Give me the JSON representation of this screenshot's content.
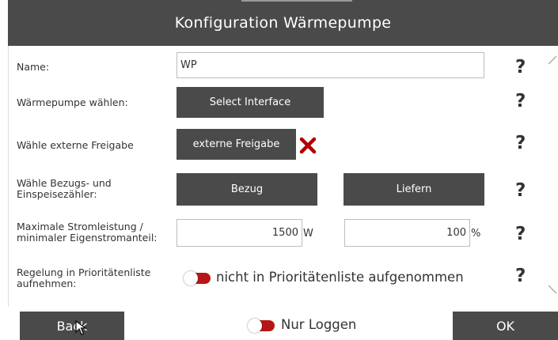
{
  "title": "Konfiguration Wärmepumpe",
  "rows": {
    "name": {
      "label": "Name:",
      "value": "WP"
    },
    "heatpump": {
      "label": "Wärmepumpe wählen:",
      "button": "Select Interface"
    },
    "release": {
      "label": "Wähle externe Freigabe",
      "button": "externe Freigabe"
    },
    "meters": {
      "label_line1": "Wähle Bezugs- und",
      "label_line2": "Einspeisezähler:",
      "button_supply": "Bezug",
      "button_feed": "Liefern"
    },
    "power": {
      "label_line1": "Maximale Stromleistung /",
      "label_line2": "minimaler Eigenstromanteil:",
      "power_value": "1500",
      "power_unit": "W",
      "share_value": "100",
      "share_unit": "%"
    },
    "priority": {
      "label_line1": "Regelung in Prioritätenliste",
      "label_line2": "aufnehmen:",
      "toggle_text": "nicht in Prioritätenliste aufgenommen"
    }
  },
  "help_symbol": "?",
  "footer": {
    "back": "Back",
    "log_only": "Nur Loggen",
    "ok": "OK"
  },
  "icons": {
    "remove": "x-icon",
    "help": "question-mark-icon",
    "scroll_up": "chevron-up-icon",
    "scroll_down": "chevron-down-icon",
    "cursor": "pointer-cursor-icon"
  },
  "colors": {
    "dark": "#4a4a4a",
    "toggle_off": "#b81616",
    "remove": "#b00000"
  }
}
